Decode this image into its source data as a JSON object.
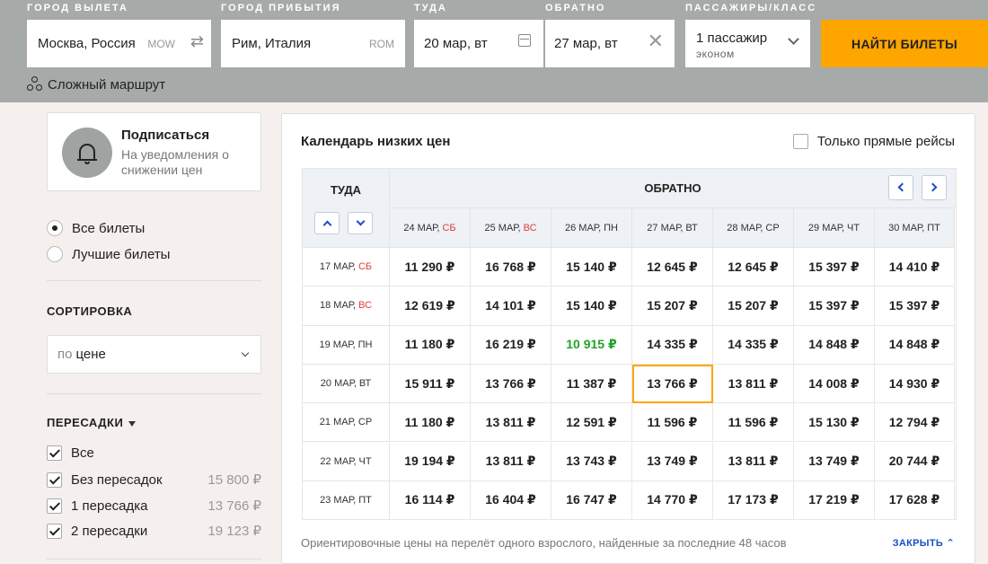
{
  "search": {
    "origin_label": "ГОРОД ВЫЛЕТА",
    "origin_value": "Москва, Россия",
    "origin_iata": "MOW",
    "dest_label": "ГОРОД ПРИБЫТИЯ",
    "dest_value": "Рим, Италия",
    "dest_iata": "ROM",
    "depart_label": "ТУДА",
    "depart_value": "20 мар, вт",
    "return_label": "ОБРАТНО",
    "return_value": "27 мар, вт",
    "pass_label": "ПАССАЖИРЫ/КЛАСС",
    "pass_value": "1 пассажир",
    "class_value": "эконом",
    "search_button": "НАЙТИ БИЛЕТЫ",
    "complex_route": "Сложный маршрут"
  },
  "sidebar": {
    "subscribe_title": "Подписаться",
    "subscribe_text": "На уведомления о снижении цен",
    "radios": [
      {
        "label": "Все билеты",
        "checked": true
      },
      {
        "label": "Лучшие билеты",
        "checked": false
      }
    ],
    "sort_title": "СОРТИРОВКА",
    "sort_prefix": "по",
    "sort_value": "цене",
    "transfers_title": "ПЕРЕСАДКИ",
    "transfers": [
      {
        "label": "Все",
        "price": "",
        "checked": true
      },
      {
        "label": "Без пересадок",
        "price": "15 800 ₽",
        "checked": true
      },
      {
        "label": "1 пересадка",
        "price": "13 766 ₽",
        "checked": true
      },
      {
        "label": "2 пересадки",
        "price": "19 123 ₽",
        "checked": true
      }
    ]
  },
  "calendar": {
    "title": "Календарь низких цен",
    "direct_only": "Только прямые рейсы",
    "depart_header": "ТУДА",
    "return_header": "ОБРАТНО",
    "columns": [
      {
        "date": "24 МАР,",
        "dow": "СБ",
        "weekend": true
      },
      {
        "date": "25 МАР,",
        "dow": "ВС",
        "weekend": true
      },
      {
        "date": "26 МАР,",
        "dow": "ПН",
        "weekend": false
      },
      {
        "date": "27 МАР,",
        "dow": "ВТ",
        "weekend": false
      },
      {
        "date": "28 МАР,",
        "dow": "СР",
        "weekend": false
      },
      {
        "date": "29 МАР,",
        "dow": "ЧТ",
        "weekend": false
      },
      {
        "date": "30 МАР,",
        "dow": "ПТ",
        "weekend": false
      }
    ],
    "rows": [
      {
        "date": "17 МАР,",
        "dow": "СБ",
        "weekend": true,
        "prices": [
          "11 290 ₽",
          "16 768 ₽",
          "15 140 ₽",
          "12 645 ₽",
          "12 645 ₽",
          "15 397 ₽",
          "14 410 ₽"
        ]
      },
      {
        "date": "18 МАР,",
        "dow": "ВС",
        "weekend": true,
        "prices": [
          "12 619 ₽",
          "14 101 ₽",
          "15 140 ₽",
          "15 207 ₽",
          "15 207 ₽",
          "15 397 ₽",
          "15 397 ₽"
        ]
      },
      {
        "date": "19 МАР,",
        "dow": "ПН",
        "weekend": false,
        "prices": [
          "11 180 ₽",
          "16 219 ₽",
          "10 915 ₽",
          "14 335 ₽",
          "14 335 ₽",
          "14 848 ₽",
          "14 848 ₽"
        ]
      },
      {
        "date": "20 МАР,",
        "dow": "ВТ",
        "weekend": false,
        "prices": [
          "15 911 ₽",
          "13 766 ₽",
          "11 387 ₽",
          "13 766 ₽",
          "13 811 ₽",
          "14 008 ₽",
          "14 930 ₽"
        ]
      },
      {
        "date": "21 МАР,",
        "dow": "СР",
        "weekend": false,
        "prices": [
          "11 180 ₽",
          "13 811 ₽",
          "12 591 ₽",
          "11 596 ₽",
          "11 596 ₽",
          "15 130 ₽",
          "12 794 ₽"
        ]
      },
      {
        "date": "22 МАР,",
        "dow": "ЧТ",
        "weekend": false,
        "prices": [
          "19 194 ₽",
          "13 811 ₽",
          "13 743 ₽",
          "13 749 ₽",
          "13 811 ₽",
          "13 749 ₽",
          "20 744 ₽"
        ]
      },
      {
        "date": "23 МАР,",
        "dow": "ПТ",
        "weekend": false,
        "prices": [
          "16 114 ₽",
          "16 404 ₽",
          "16 747 ₽",
          "14 770 ₽",
          "17 173 ₽",
          "17 219 ₽",
          "17 628 ₽"
        ]
      }
    ],
    "lowest": {
      "row": 2,
      "col": 2
    },
    "selected": {
      "row": 3,
      "col": 3
    },
    "note": "Ориентировочные цены на перелёт одного взрослого, найденные за последние 48 часов",
    "close_link": "ЗАКРЫТЬ"
  },
  "colors": {
    "header_bg": "#a6aaa9",
    "accent": "#ffa500",
    "link": "#1a4fc4",
    "lowest_price": "#22a02b",
    "weekend": "#e0403a"
  }
}
